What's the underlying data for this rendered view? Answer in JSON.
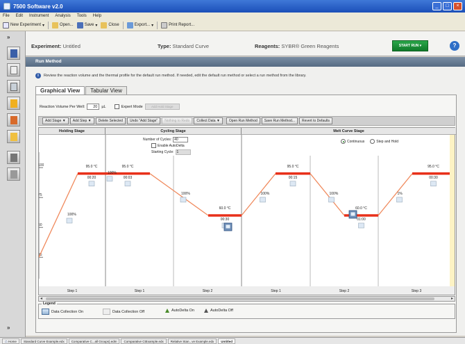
{
  "window": {
    "title": "7500 Software v2.0"
  },
  "menubar": [
    "File",
    "Edit",
    "Instrument",
    "Analysis",
    "Tools",
    "Help"
  ],
  "toolbar": {
    "new_experiment": "New Experiment",
    "open": "Open...",
    "save": "Save",
    "close": "Close",
    "export": "Export...",
    "print_report": "Print Report..."
  },
  "header": {
    "experiment_label": "Experiment:",
    "experiment_value": "Untitled",
    "type_label": "Type:",
    "type_value": "Standard Curve",
    "reagents_label": "Reagents:",
    "reagents_value": "SYBR® Green Reagents",
    "start_run": "START RUN"
  },
  "run_method": {
    "bar_title": "Run Method",
    "info": "Review the reaction volume and the thermal profile for the default run method. If needed, edit the default run method or select a run method from the library.",
    "tabs": [
      "Graphical View",
      "Tabular View"
    ],
    "reaction_volume_label": "Reaction Volume Per Well:",
    "reaction_volume_value": "20",
    "reaction_volume_unit": "µL",
    "expert_mode": "Expert Mode",
    "expert_btn": "Add Hold Stage",
    "buttons": {
      "add_stage": "Add Stage",
      "add_step": "Add Step",
      "delete_selected": "Delete Selected",
      "undo": "Undo \"Add Stage\"",
      "redo": "Nothing to Redo",
      "collect_data": "Collect Data",
      "open_run_method": "Open Run Method",
      "save_run_method": "Save Run Method...",
      "revert": "Revert to Defaults"
    }
  },
  "profile": {
    "stages": [
      "Holding Stage",
      "Cycling Stage",
      "Melt Curve Stage"
    ],
    "cycling": {
      "cycles_label": "Number of Cycles:",
      "cycles_value": "40",
      "autodelta": "Enable AutoDelta",
      "starting_cycle_label": "Starting Cycle:",
      "starting_cycle_value": "1"
    },
    "melt": {
      "continuous": "Continuous",
      "step_hold": "Step and Hold"
    },
    "y_ticks": [
      "100",
      "75",
      "50",
      "25"
    ],
    "steps": [
      {
        "name": "Step 1",
        "temp": "95.0 °C",
        "time": "00:20",
        "ramp": "100%"
      },
      {
        "name": "Step 1",
        "temp": "95.0 °C",
        "time": "00:03",
        "ramp": "100%"
      },
      {
        "name": "Step 2",
        "temp": "60.0 °C",
        "time": "00:30",
        "ramp": "100%"
      },
      {
        "name": "Step 1",
        "temp": "95.0 °C",
        "time": "00:15",
        "ramp": "100%"
      },
      {
        "name": "Step 2",
        "temp": "60.0 °C",
        "time": "01:00",
        "ramp": "100%"
      },
      {
        "name": "Step 3",
        "temp": "95.0 °C",
        "time": "00:30",
        "ramp": "1%"
      }
    ]
  },
  "legend": {
    "title": "Legend",
    "dc_on": "Data Collection On",
    "dc_off": "Data Collection Off",
    "ad_on": "AutoDelta On",
    "ad_off": "AutoDelta Off"
  },
  "status_tabs": [
    "Home",
    "Standard Curve Example.edx",
    "Comparative C...all Groups).edm",
    "Comparative CtExample.edx",
    "Relative Stan...ve Example.edx",
    "Untitled"
  ],
  "colors": {
    "profile_line": "#f08a5d",
    "hold_segment": "#e8301a",
    "accent": "#2aa64a"
  }
}
